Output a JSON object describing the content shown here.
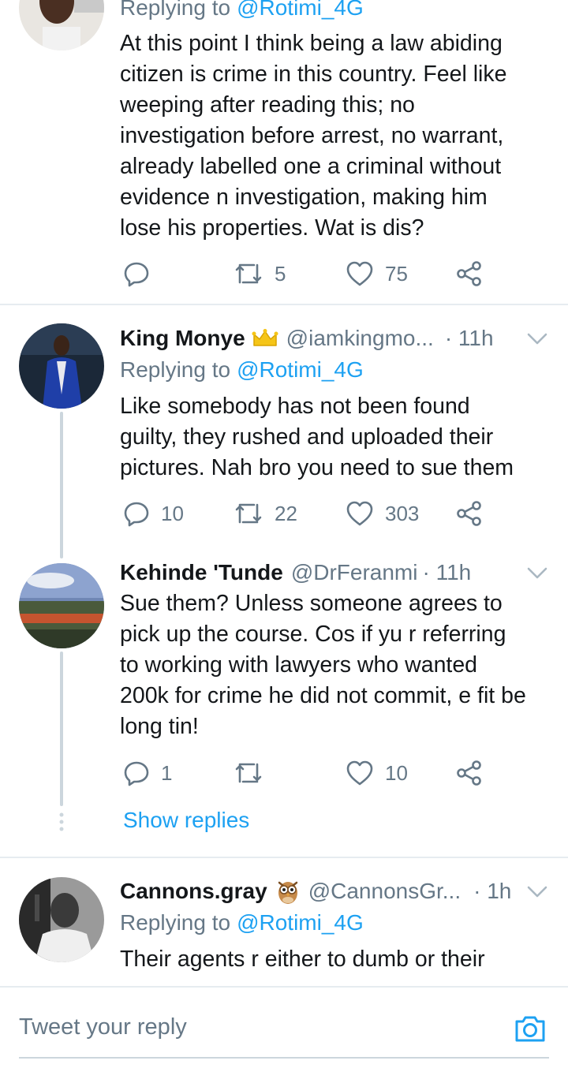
{
  "tweets": [
    {
      "replying_label": "Replying to",
      "replying_to": "@Rotimi_4G",
      "text": "At this point I think being a law abiding\ncitizen is crime in this country. Feel like\nweeping after reading this; no\ninvestigation before arrest, no warrant,\nalready labelled one a criminal without\nevidence n investigation, making him\nlose his properties. Wat is dis?",
      "replies": "",
      "retweets": "5",
      "likes": "75"
    },
    {
      "name": "King Monye",
      "badge": "crown-emoji",
      "handle": "@iamkingmo...",
      "time": "· 11h",
      "replying_label": "Replying to",
      "replying_to": "@Rotimi_4G",
      "text": "Like somebody has not been found\nguilty, they rushed and uploaded their\npictures. Nah bro you need to sue them",
      "replies": "10",
      "retweets": "22",
      "likes": "303"
    },
    {
      "name": "Kehinde 'Tunde",
      "handle": "@DrFeranmi",
      "time": "· 11h",
      "text": "Sue them? Unless someone agrees to\npick up the course.  Cos if yu r referring\nto working with lawyers who wanted\n200k for crime he did not commit, e fit be\nlong tin!",
      "replies": "1",
      "retweets": "",
      "likes": "10",
      "show_replies": "Show replies"
    },
    {
      "name": "Cannons.gray",
      "badge": "owl-emoji",
      "handle": "@CannonsGr...",
      "time": "· 1h",
      "replying_label": "Replying to",
      "replying_to": "@Rotimi_4G",
      "text": "Their agents r either to dumb or their"
    }
  ],
  "composer": {
    "placeholder": "Tweet your reply"
  },
  "colors": {
    "link": "#1da1f2",
    "secondary_text": "#657786",
    "primary_text": "#14171a",
    "divider": "#e6ecf0"
  }
}
